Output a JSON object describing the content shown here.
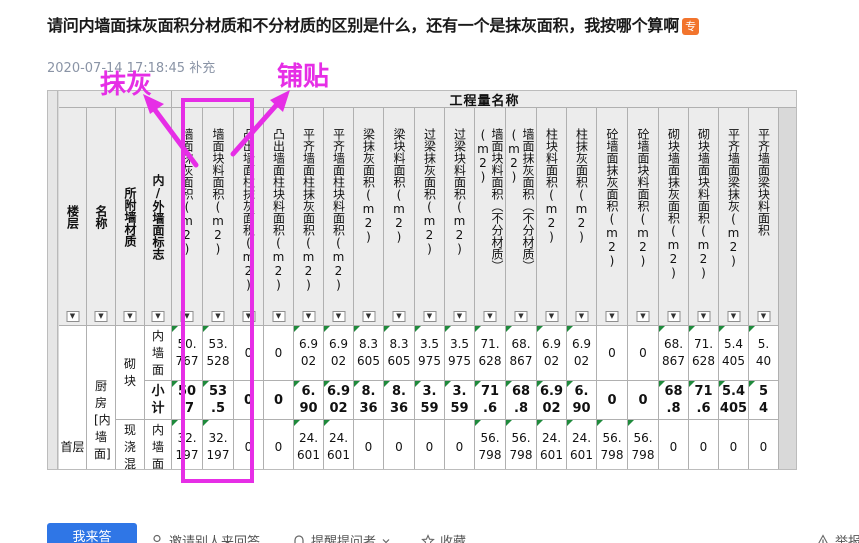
{
  "question": {
    "title": "请问内墙面抹灰面积分材质和不分材质的区别是什么，还有一个是抹灰面积，我按哪个算啊",
    "badge": "专",
    "date": "2020-07-14 17:18:45",
    "supplement": "补充"
  },
  "annotations": {
    "plaster": "抹灰",
    "tile": "铺贴",
    "color": "#e62ee6"
  },
  "table": {
    "group_header": "工程量名称",
    "headers": [
      {
        "key": "floor",
        "label": "楼层",
        "bold": true
      },
      {
        "key": "name",
        "label": "名称",
        "bold": true
      },
      {
        "key": "material",
        "label": "所附墙材质",
        "bold": true
      },
      {
        "key": "inout",
        "label": "内/外墙面标志",
        "bold": true
      },
      {
        "key": "c1",
        "label": "墙面抹灰面积(m2)"
      },
      {
        "key": "c2",
        "label": "墙面块料面积(m2)"
      },
      {
        "key": "c3",
        "label": "凸出墙面柱抹灰面积(m2)"
      },
      {
        "key": "c4",
        "label": "凸出墙面柱块料面积(m2)"
      },
      {
        "key": "c5",
        "label": "平齐墙面柱抹灰面积(m2)"
      },
      {
        "key": "c6",
        "label": "平齐墙面柱块料面积(m2)"
      },
      {
        "key": "c7",
        "label": "梁抹灰面积(m2)"
      },
      {
        "key": "c8",
        "label": "梁块料面积(m2)"
      },
      {
        "key": "c9",
        "label": "过梁抹灰面积(m2)"
      },
      {
        "key": "c10",
        "label": "过梁块料面积(m2)"
      },
      {
        "key": "c11",
        "label": "墙面块料面积（不分材质）(m2)"
      },
      {
        "key": "c12",
        "label": "墙面抹灰面积（不分材质）(m2)"
      },
      {
        "key": "c13",
        "label": "柱块料面积(m2)"
      },
      {
        "key": "c14",
        "label": "柱抹灰面积(m2)"
      },
      {
        "key": "c15",
        "label": "砼墙面抹灰面积(m2)"
      },
      {
        "key": "c16",
        "label": "砼墙面块料面积(m2)"
      },
      {
        "key": "c17",
        "label": "砌块墙面抹灰面积(m2)"
      },
      {
        "key": "c18",
        "label": "砌块墙面块料面积(m2)"
      },
      {
        "key": "c19",
        "label": "平齐墙面梁抹灰(m2)"
      },
      {
        "key": "c20",
        "label": "平齐墙面梁块料面积"
      }
    ],
    "floor_label": "首层",
    "room_label": "厨房[内墙面]",
    "material_a": "砌块",
    "material_b": "现浇混",
    "row1": {
      "inout": "内墙面",
      "vals": [
        "50.\n767",
        "53.\n528",
        "0",
        "0",
        "6.9\n02",
        "6.9\n02",
        "8.3\n605",
        "8.3\n605",
        "3.5\n975",
        "3.5\n975",
        "71.\n628",
        "68.\n867",
        "6.9\n02",
        "6.9\n02",
        "0",
        "0",
        "68.\n867",
        "71.\n628",
        "5.4\n405",
        "5.\n40"
      ]
    },
    "row2": {
      "inout": "小计",
      "vals": [
        "50\n.7",
        "53\n.5",
        "0",
        "0",
        "6.\n90",
        "6.9\n02",
        "8.\n36",
        "8.\n36",
        "3.\n59",
        "3.\n59",
        "71\n.6",
        "68\n.8",
        "6.9\n02",
        "6.\n90",
        "0",
        "0",
        "68\n.8",
        "71\n.6",
        "5.4\n405",
        "5\n4"
      ]
    },
    "row3": {
      "inout": "内墙面",
      "vals": [
        "32.\n197",
        "32.\n197",
        "0",
        "0",
        "24.\n601",
        "24.\n601",
        "0",
        "0",
        "0",
        "0",
        "56.\n798",
        "56.\n798",
        "24.\n601",
        "24.\n601",
        "56.\n798",
        "56.\n798",
        "0",
        "0",
        "0",
        "0"
      ]
    }
  },
  "footer": {
    "answer_btn": "我来答",
    "invite": "邀请别人来回答",
    "remind": "提醒提问者",
    "favorite": "收藏",
    "report": "举报"
  },
  "colors": {
    "accent_blue": "#2f76e6",
    "highlight_magenta": "#e62ee6",
    "badge_orange": "#f2742d"
  }
}
